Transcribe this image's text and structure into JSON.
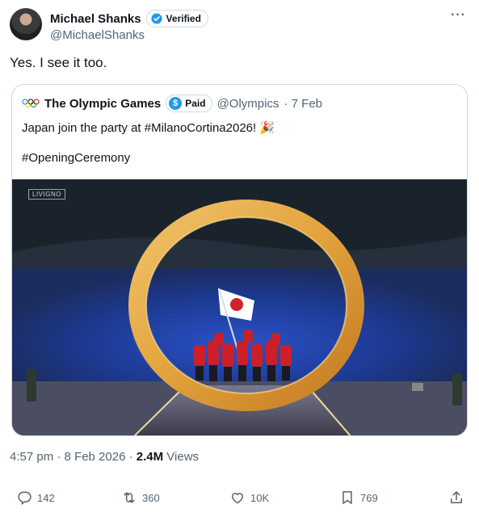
{
  "author": {
    "name": "Michael Shanks",
    "verified_label": "Verified",
    "handle": "@MichaelShanks"
  },
  "more_icon": "more-options-icon",
  "tweet_text": "Yes. I see it too.",
  "quote": {
    "name": "The Olympic Games",
    "paid_label": "Paid",
    "paid_symbol": "$",
    "handle": "@Olympics",
    "date": "· 7 Feb",
    "text_line1": "Japan join the party at #MilanoCortina2026! 🎉",
    "text_line2": "#OpeningCeremony",
    "media_label": "LIVIGNO"
  },
  "meta": {
    "time": "4:57 pm · 8 Feb 2026 · ",
    "views_count": "2.4M",
    "views_label": " Views"
  },
  "actions": {
    "replies": "142",
    "reposts": "360",
    "likes": "10K",
    "bookmarks": "769"
  },
  "colors": {
    "verified_blue": "#1d9bf0",
    "secondary_text": "#536471",
    "border": "#cfd9de"
  }
}
